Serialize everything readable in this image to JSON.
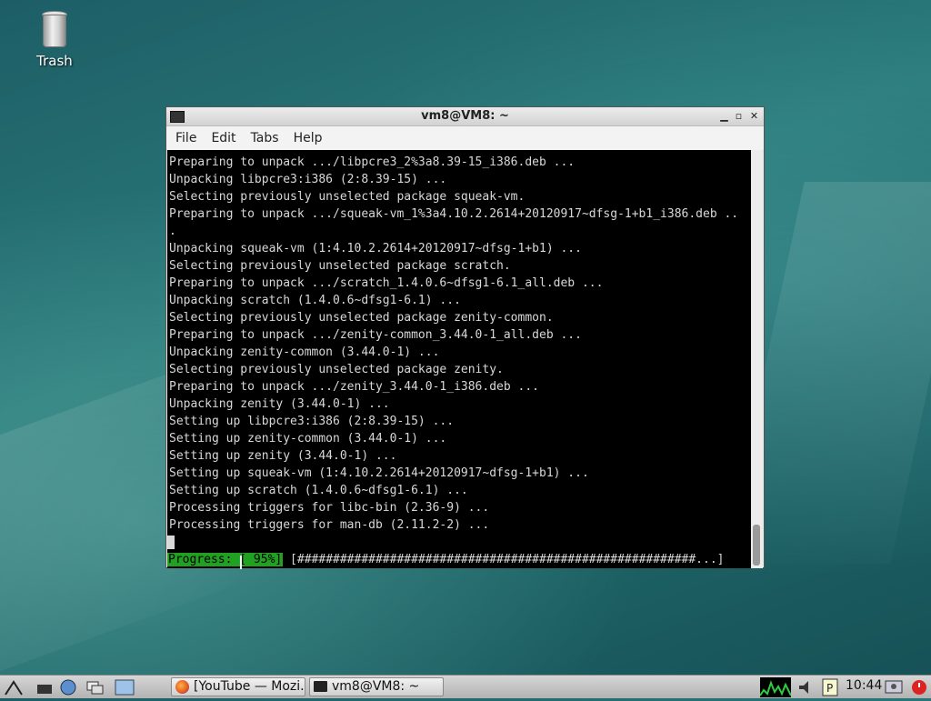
{
  "desktop": {
    "icons": [
      {
        "label": "Trash",
        "icon": "trash-icon"
      }
    ]
  },
  "window": {
    "title": "vm8@VM8: ~",
    "menu": [
      "File",
      "Edit",
      "Tabs",
      "Help"
    ],
    "lines": [
      "Preparing to unpack .../libpcre3_2%3a8.39-15_i386.deb ...",
      "Unpacking libpcre3:i386 (2:8.39-15) ...",
      "Selecting previously unselected package squeak-vm.",
      "Preparing to unpack .../squeak-vm_1%3a4.10.2.2614+20120917~dfsg-1+b1_i386.deb ..",
      ".",
      "Unpacking squeak-vm (1:4.10.2.2614+20120917~dfsg-1+b1) ...",
      "Selecting previously unselected package scratch.",
      "Preparing to unpack .../scratch_1.4.0.6~dfsg1-6.1_all.deb ...",
      "Unpacking scratch (1.4.0.6~dfsg1-6.1) ...",
      "Selecting previously unselected package zenity-common.",
      "Preparing to unpack .../zenity-common_3.44.0-1_all.deb ...",
      "Unpacking zenity-common (3.44.0-1) ...",
      "Selecting previously unselected package zenity.",
      "Preparing to unpack .../zenity_3.44.0-1_i386.deb ...",
      "Unpacking zenity (3.44.0-1) ...",
      "Setting up libpcre3:i386 (2:8.39-15) ...",
      "Setting up zenity-common (3.44.0-1) ...",
      "Setting up zenity (3.44.0-1) ...",
      "Setting up squeak-vm (1:4.10.2.2614+20120917~dfsg-1+b1) ...",
      "Setting up scratch (1.4.0.6~dfsg1-6.1) ...",
      "Processing triggers for libc-bin (2.36-9) ...",
      "Processing triggers for man-db (2.11.2-2) ..."
    ],
    "progress_label": "Progress: [ 95%]",
    "progress_bar": " [########################################################...]",
    "progress_percent": 95
  },
  "taskbar": {
    "launchers": [
      "start-menu-icon",
      "show-desktop-icon",
      "browser-icon",
      "window-switch-icon",
      "workspace-icon"
    ],
    "tasks": [
      {
        "label": "[YouTube — Mozi...",
        "icon": "firefox-icon"
      },
      {
        "label": "vm8@VM8: ~",
        "icon": "terminal-icon"
      }
    ],
    "clock": "10:44",
    "tray": [
      "cpu-monitor-icon",
      "volume-icon",
      "clipboard-icon",
      "user-icon",
      "power-icon"
    ]
  }
}
